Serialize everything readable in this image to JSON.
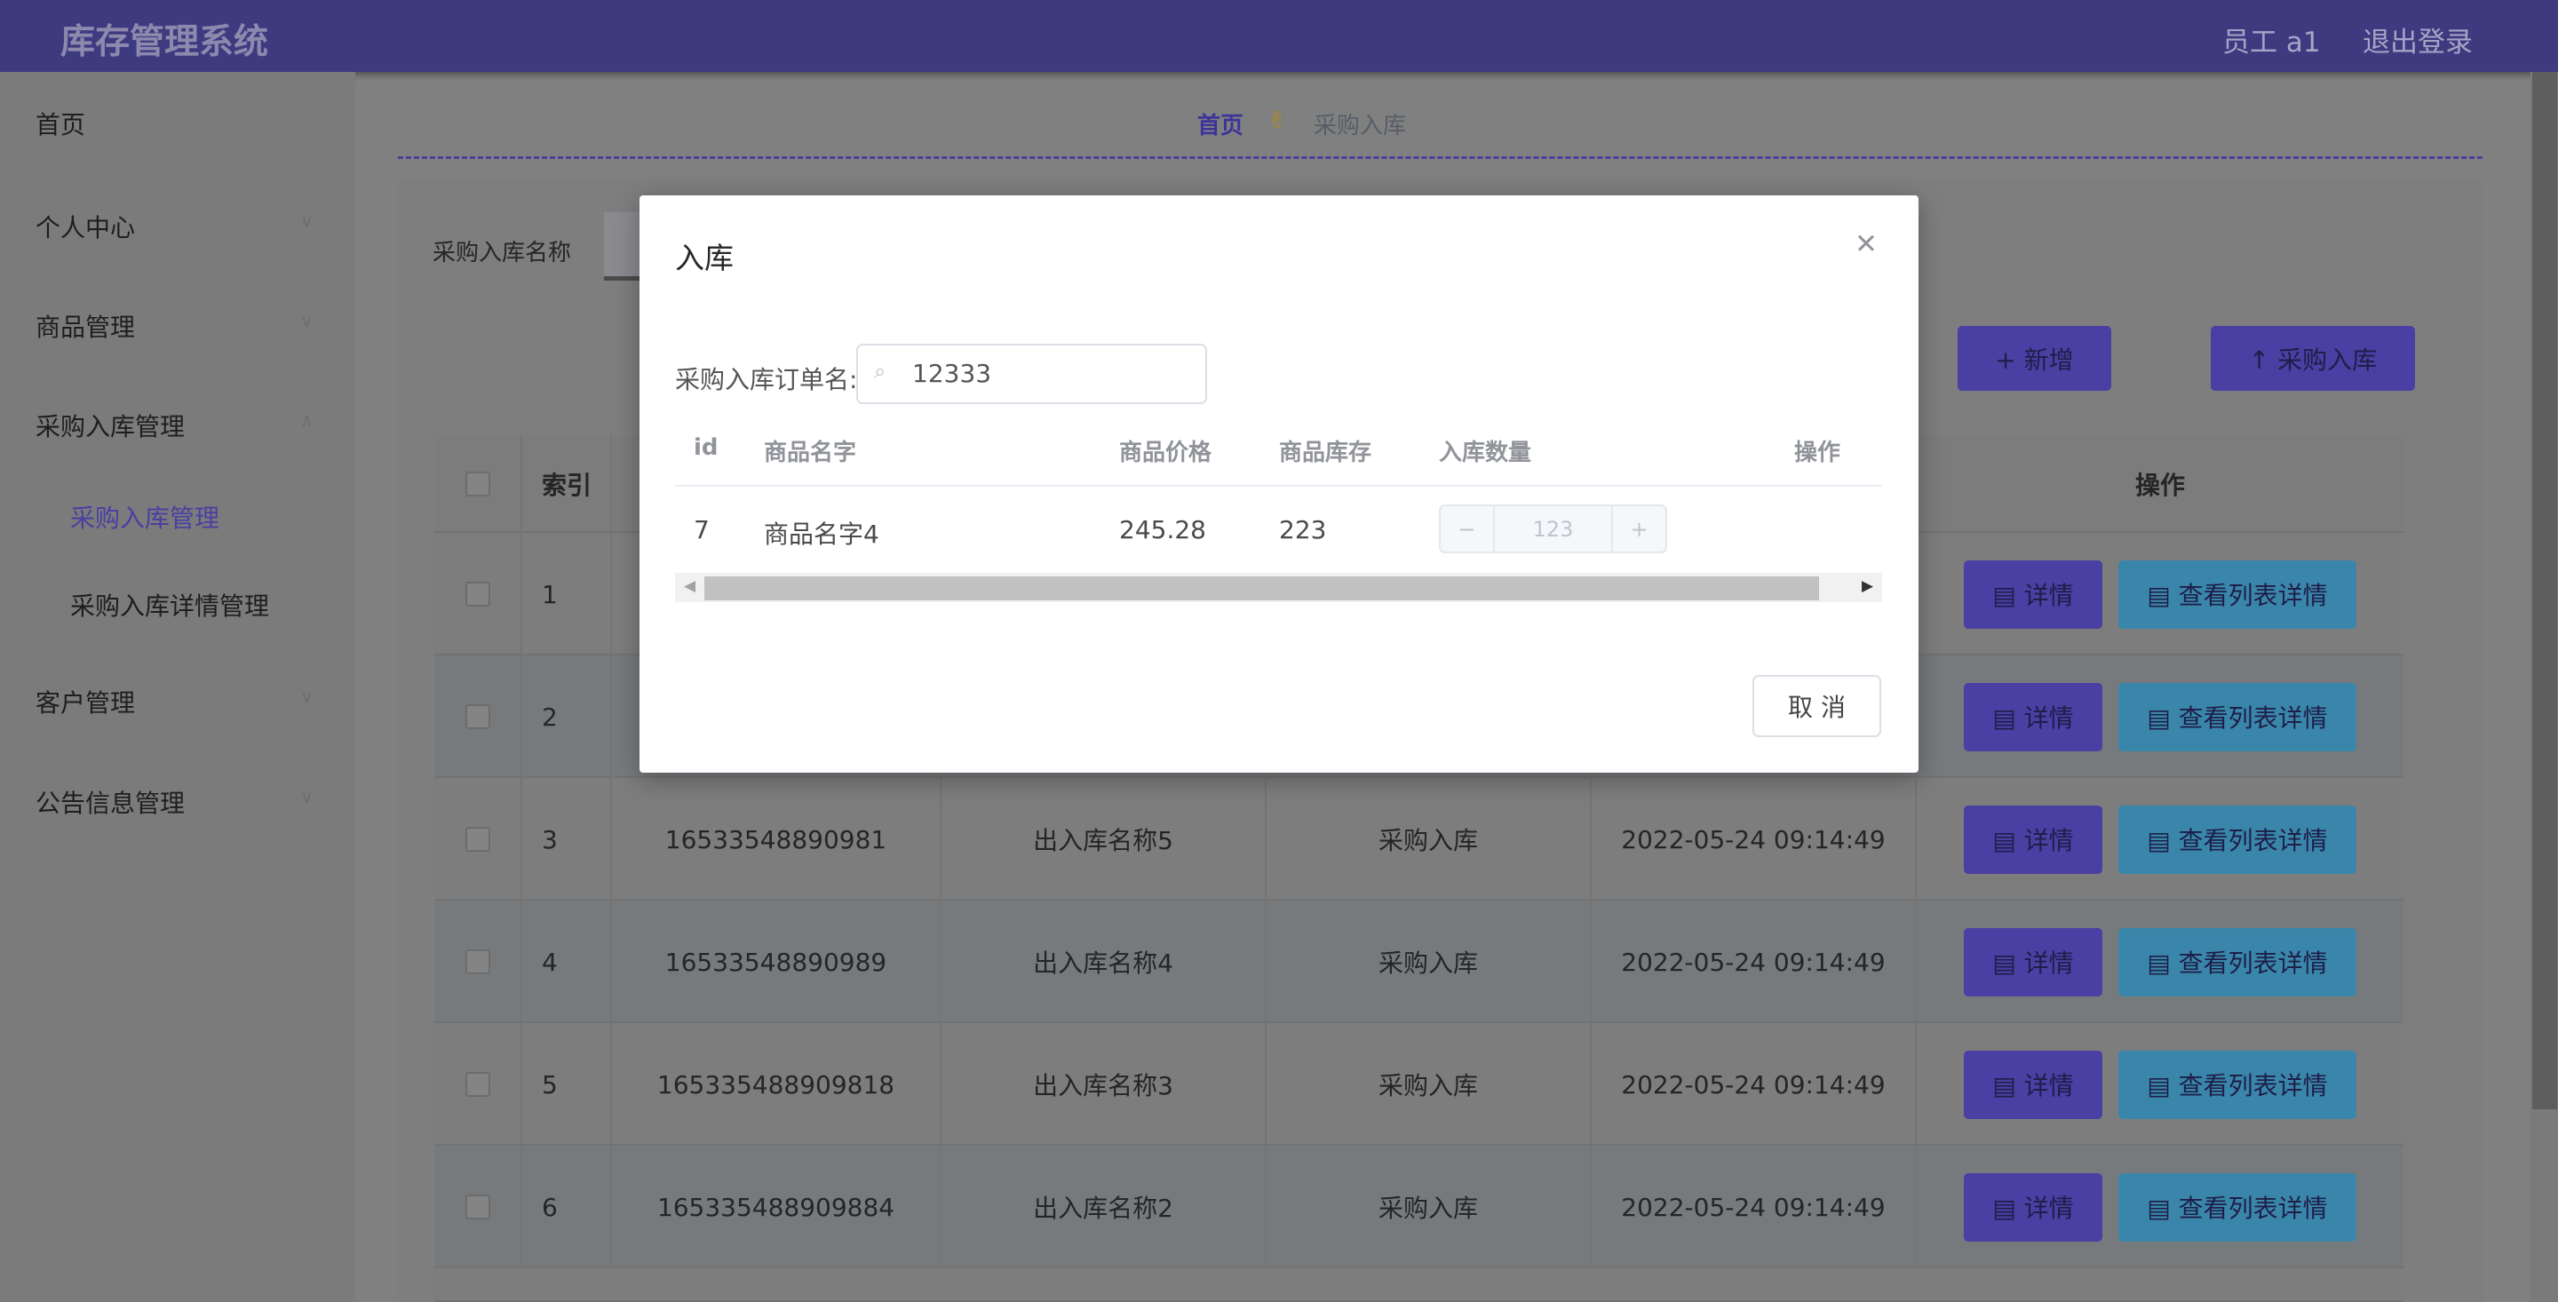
{
  "header": {
    "title": "库存管理系统",
    "user": "员工 a1",
    "logout": "退出登录"
  },
  "sidebar": {
    "items": [
      {
        "label": "首页"
      },
      {
        "label": "个人中心"
      },
      {
        "label": "商品管理"
      },
      {
        "label": "采购入库管理"
      },
      {
        "label": "采购入库管理"
      },
      {
        "label": "采购入库详情管理"
      },
      {
        "label": "客户管理"
      },
      {
        "label": "公告信息管理"
      }
    ]
  },
  "breadcrumb": {
    "home": "首页",
    "separator": "✌",
    "current": "采购入库"
  },
  "search": {
    "label": "采购入库名称"
  },
  "toolbar": {
    "add": "+ 新增",
    "purchase_in": "↑ 采购入库"
  },
  "table": {
    "headers": {
      "index": "索引",
      "actions": "操作"
    },
    "detail_btn": "详情",
    "list_detail_btn": "查看列表详情",
    "rows": [
      {
        "index": "1"
      },
      {
        "index": "2"
      },
      {
        "index": "3",
        "code": "16533548890981",
        "name": "出入库名称5",
        "type": "采购入库",
        "time": "2022-05-24 09:14:49"
      },
      {
        "index": "4",
        "code": "16533548890989",
        "name": "出入库名称4",
        "type": "采购入库",
        "time": "2022-05-24 09:14:49"
      },
      {
        "index": "5",
        "code": "165335488909818",
        "name": "出入库名称3",
        "type": "采购入库",
        "time": "2022-05-24 09:14:49"
      },
      {
        "index": "6",
        "code": "165335488909884",
        "name": "出入库名称2",
        "type": "采购入库",
        "time": "2022-05-24 09:14:49"
      }
    ]
  },
  "modal": {
    "title": "入库",
    "order_label": "采购入库订单名:",
    "order_value": "12333",
    "columns": [
      "id",
      "商品名字",
      "商品价格",
      "商品库存",
      "入库数量",
      "操作"
    ],
    "row": {
      "id": "7",
      "name": "商品名字4",
      "price": "245.28",
      "stock": "223",
      "quantity": "123"
    },
    "stepper": {
      "minus": "−",
      "plus": "+"
    },
    "cancel": "取 消"
  },
  "colors": {
    "header": "#3e3a80",
    "accent": "#4a3fa2",
    "teal": "#3a86aa"
  }
}
